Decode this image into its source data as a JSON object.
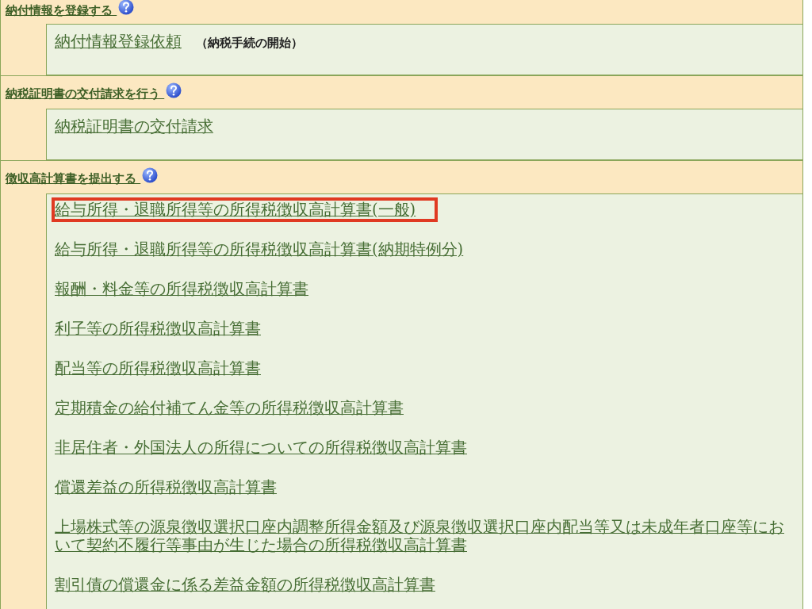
{
  "sections": [
    {
      "heading": "納付情報を登録する",
      "help": true,
      "items": [
        {
          "label": "納付情報登録依頼",
          "note": "（納税手続の開始）",
          "highlighted": false
        }
      ]
    },
    {
      "heading": "納税証明書の交付請求を行う",
      "help": true,
      "items": [
        {
          "label": "納税証明書の交付請求",
          "highlighted": false
        }
      ]
    },
    {
      "heading": "徴収高計算書を提出する",
      "help": true,
      "items": [
        {
          "label": "給与所得・退職所得等の所得税徴収高計算書(一般)",
          "highlighted": true
        },
        {
          "label": "給与所得・退職所得等の所得税徴収高計算書(納期特例分)",
          "highlighted": false
        },
        {
          "label": "報酬・料金等の所得税徴収高計算書",
          "highlighted": false
        },
        {
          "label": "利子等の所得税徴収高計算書",
          "highlighted": false
        },
        {
          "label": "配当等の所得税徴収高計算書",
          "highlighted": false
        },
        {
          "label": "定期積金の給付補てん金等の所得税徴収高計算書",
          "highlighted": false
        },
        {
          "label": "非居住者・外国法人の所得についての所得税徴収高計算書",
          "highlighted": false
        },
        {
          "label": "償還差益の所得税徴収高計算書",
          "highlighted": false
        },
        {
          "label": "上場株式等の源泉徴収選択口座内調整所得金額及び源泉徴収選択口座内配当等又は未成年者口座等において契約不履行等事由が生じた場合の所得税徴収高計算書",
          "highlighted": false
        },
        {
          "label": "割引債の償還金に係る差益金額の所得税徴収高計算書",
          "highlighted": false
        }
      ]
    }
  ]
}
